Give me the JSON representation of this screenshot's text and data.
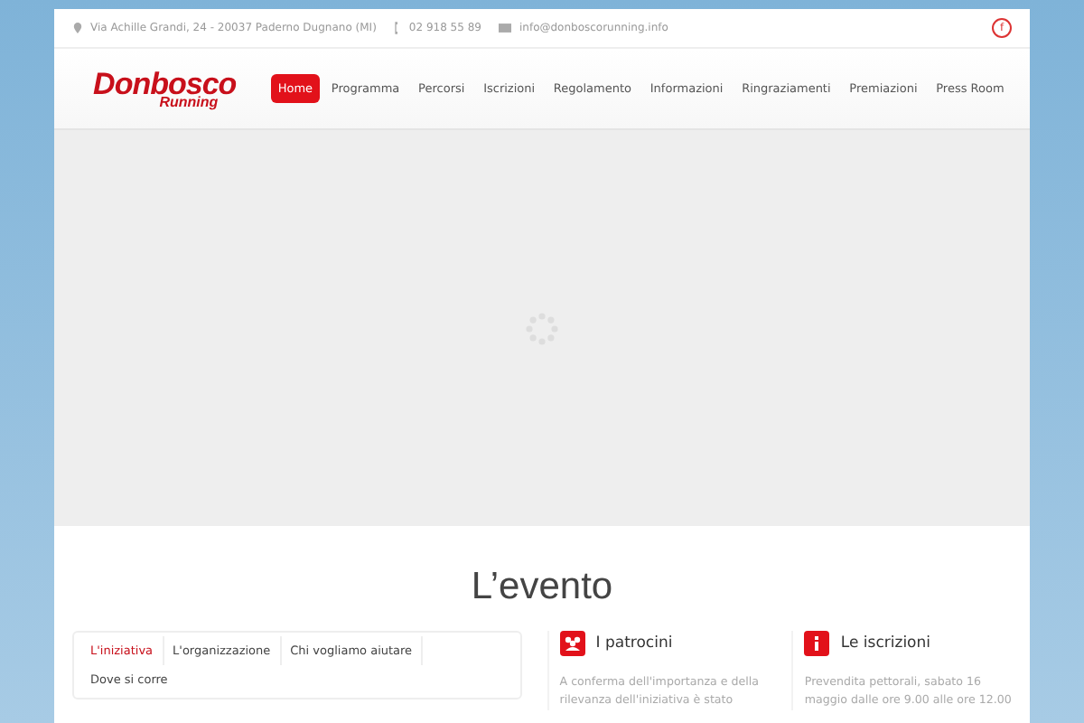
{
  "topbar": {
    "address": "Via Achille Grandi, 24 - 20037 Paderno Dugnano (MI)",
    "phone": "02 918 55 89",
    "email": "info@donboscorunning.info",
    "social": "f"
  },
  "logo": {
    "main": "Donbosco",
    "sub": "Running"
  },
  "nav": [
    {
      "label": "Home",
      "selected": true
    },
    {
      "label": "Programma",
      "selected": false
    },
    {
      "label": "Percorsi",
      "selected": false
    },
    {
      "label": "Iscrizioni",
      "selected": false
    },
    {
      "label": "Regolamento",
      "selected": false
    },
    {
      "label": "Informazioni",
      "selected": false
    },
    {
      "label": "Ringraziamenti",
      "selected": false
    },
    {
      "label": "Premiazioni",
      "selected": false
    },
    {
      "label": "Press Room",
      "selected": false
    }
  ],
  "section_title": "L’evento",
  "tabs": [
    {
      "label": "L'iniziativa",
      "selected": true
    },
    {
      "label": "L'organizzazione",
      "selected": false
    },
    {
      "label": "Chi vogliamo aiutare",
      "selected": false
    },
    {
      "label": "Dove si corre",
      "selected": false
    }
  ],
  "cards": [
    {
      "kind": "group",
      "title": "I patrocini",
      "text": "A conferma dell'importanza e della rilevanza dell'iniziativa è stato"
    },
    {
      "kind": "info",
      "title": "Le iscrizioni",
      "text": "Prevendita pettorali, sabato 16 maggio dalle ore 9.00 alle ore 12.00"
    }
  ]
}
